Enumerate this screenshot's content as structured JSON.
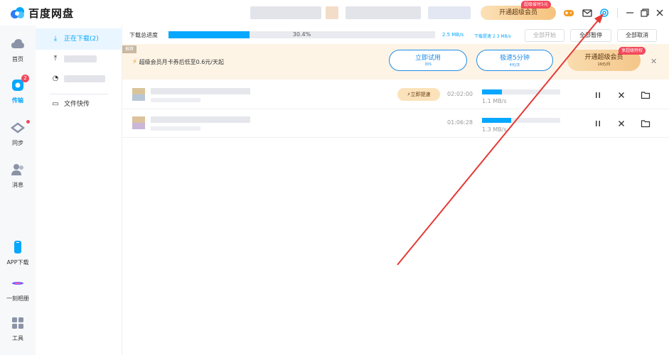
{
  "app": {
    "title": "百度网盘"
  },
  "topbar": {
    "vip_button": "开通超级会员",
    "vip_tag": "超级省时5元"
  },
  "leftnav": {
    "items": [
      {
        "label": "首页",
        "icon": "cloud-icon"
      },
      {
        "label": "传输",
        "icon": "transfer-icon",
        "badge": "2"
      },
      {
        "label": "同步",
        "icon": "sync-icon"
      },
      {
        "label": "消息",
        "icon": "users-icon"
      },
      {
        "label": "APP下载",
        "icon": "phone-icon"
      },
      {
        "label": "一刻相册",
        "icon": "album-icon"
      },
      {
        "label": "工具",
        "icon": "tools-icon"
      }
    ]
  },
  "subnav": {
    "downloading": "正在下载(2)",
    "quick_transfer": "文件快传"
  },
  "totalbar": {
    "label": "下载总进度",
    "percent_text": "30.4%",
    "progress": 0.304,
    "speed": "2.5 MB/s",
    "speed_sub": "下载提速 2.3 MB/s",
    "start_all": "全部开始",
    "pause_all": "全部暂停",
    "cancel_all": "全部取消"
  },
  "promo": {
    "tag": "推荐",
    "text": "超级会员月卡券后低至0.6元/天起",
    "try_main": "立即试用",
    "try_sub": "30S",
    "speed_main": "极速5分钟",
    "speed_sub": "4元/次",
    "vip_main": "开通超级会员",
    "vip_sub": "19元/月",
    "vip_tag": "享超级特权"
  },
  "downloads": [
    {
      "accelerate": "立即提速",
      "time": "02:02:00",
      "progress": 0.25,
      "speed": "1.1 MB/s"
    },
    {
      "time": "01:06:28",
      "progress": 0.37,
      "speed": "1.3 MB/s"
    }
  ],
  "colors": {
    "accent": "#06a7ff",
    "arrow": "#e53935",
    "promo_bg": "#fdf4e6"
  }
}
